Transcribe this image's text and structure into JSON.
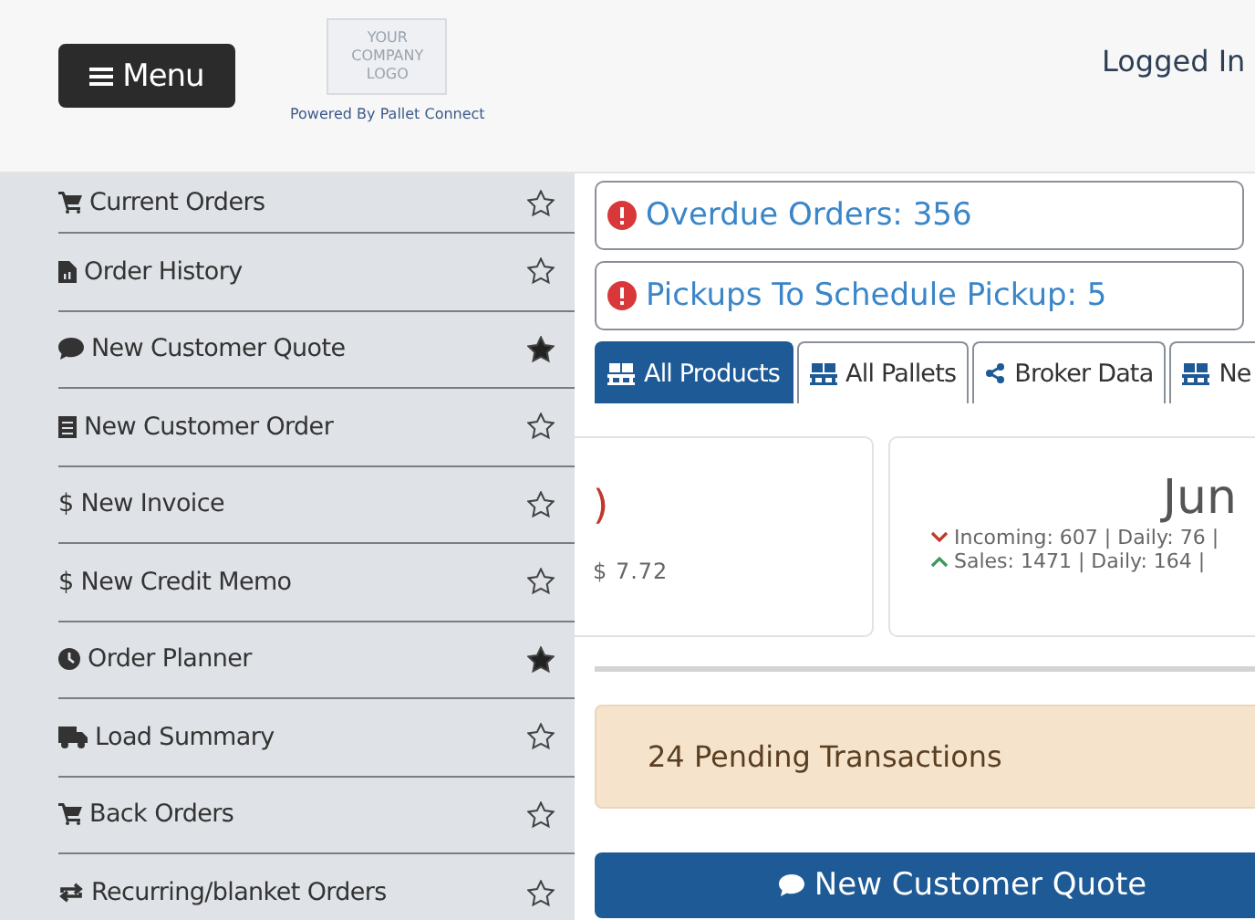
{
  "header": {
    "menu_button": "Menu",
    "logo": {
      "lines": [
        "YOUR",
        "COMPANY",
        "LOGO"
      ]
    },
    "powered_by": "Powered By Pallet Connect",
    "user": "Logged In"
  },
  "sidebar": {
    "items": [
      {
        "kind": "cart",
        "label": "Current Orders",
        "favorite": false
      },
      {
        "kind": "file",
        "label": "Order History",
        "favorite": false
      },
      {
        "kind": "comment",
        "label": "New Customer Quote",
        "favorite": true
      },
      {
        "kind": "doc",
        "label": "New Customer Order",
        "favorite": false
      },
      {
        "kind": "plain",
        "label": "$ New Invoice",
        "favorite": false
      },
      {
        "kind": "plain",
        "label": "$ New Credit Memo",
        "favorite": false
      },
      {
        "kind": "clock",
        "label": "Order Planner",
        "favorite": true
      },
      {
        "kind": "truck",
        "label": "Load Summary",
        "favorite": false
      },
      {
        "kind": "cart",
        "label": "Back Orders",
        "favorite": false
      },
      {
        "kind": "repeat",
        "label": "Recurring/blanket Orders",
        "favorite": false
      }
    ]
  },
  "alerts": [
    {
      "text": "Overdue Orders: 356"
    },
    {
      "text": "Pickups To Schedule Pickup: 5"
    }
  ],
  "tabs": [
    {
      "kind": "pallet",
      "label": "All Products",
      "selected": true
    },
    {
      "kind": "pallet",
      "label": "All Pallets",
      "selected": false
    },
    {
      "kind": "share",
      "label": "Broker Data",
      "selected": false
    },
    {
      "kind": "pallet",
      "label": "Ne",
      "selected": false
    }
  ],
  "cards": [
    {
      "lines": [
        {
          "text": ")",
          "kind": "accent"
        },
        {
          "text": "$ 7.72",
          "kind": "plain"
        }
      ]
    },
    {
      "title": "Jun",
      "lines": [
        {
          "text": "Incoming: 607 | Daily: 76 |",
          "kind": "down"
        },
        {
          "text": "Sales: 1471 | Daily: 164 |",
          "kind": "up"
        }
      ]
    }
  ],
  "pending": "24 Pending Transactions",
  "quote_button": "New Customer Quote"
}
